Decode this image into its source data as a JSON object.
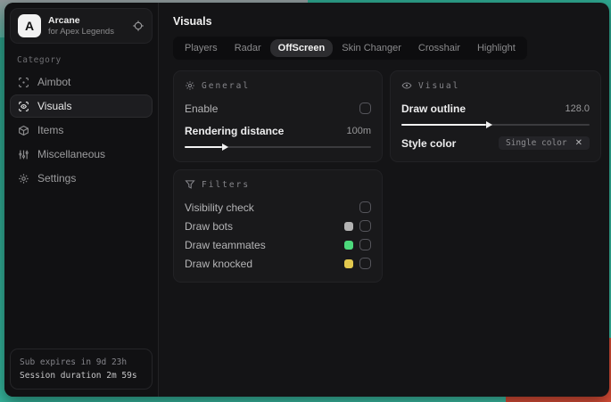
{
  "sidebar": {
    "logo_letter": "A",
    "app_name": "Arcane",
    "app_subtitle": "for Apex Legends",
    "category_label": "Category",
    "items": [
      {
        "label": "Aimbot",
        "icon": "aimbot-crosshair",
        "selected": false
      },
      {
        "label": "Visuals",
        "icon": "scan-eye",
        "selected": true
      },
      {
        "label": "Items",
        "icon": "package",
        "selected": false
      },
      {
        "label": "Miscellaneous",
        "icon": "sliders",
        "selected": false
      },
      {
        "label": "Settings",
        "icon": "gear",
        "selected": false
      }
    ],
    "footer": {
      "line1": "Sub expires in 9d 23h",
      "line2": "Session duration 2m 59s"
    }
  },
  "main": {
    "title": "Visuals",
    "tabs": [
      {
        "label": "Players",
        "selected": false
      },
      {
        "label": "Radar",
        "selected": false
      },
      {
        "label": "OffScreen",
        "selected": true
      },
      {
        "label": "Skin Changer",
        "selected": false
      },
      {
        "label": "Crosshair",
        "selected": false
      },
      {
        "label": "Highlight",
        "selected": false
      }
    ],
    "panels": {
      "general": {
        "title": "General",
        "enable_label": "Enable",
        "enable_checked": false,
        "rendering": {
          "label": "Rendering distance",
          "value": "100m",
          "fill": "20%"
        }
      },
      "visual": {
        "title": "Visual",
        "outline": {
          "label": "Draw outline",
          "value": "128.0",
          "fill": "45%"
        },
        "style": {
          "label": "Style color",
          "value": "Single color",
          "clear": "✕"
        }
      },
      "filters": {
        "title": "Filters",
        "rows": [
          {
            "label": "Visibility check",
            "swatch": null,
            "checked": false
          },
          {
            "label": "Draw bots",
            "swatch": "#b3b3b3",
            "checked": false
          },
          {
            "label": "Draw teammates",
            "swatch": "#4cd97b",
            "checked": false
          },
          {
            "label": "Draw knocked",
            "swatch": "#e2c84e",
            "checked": false
          }
        ]
      }
    }
  },
  "colors": {
    "accent_teal": "#35b89e",
    "desktop_red": "#df4f38",
    "swatch_gray": "#b3b3b3",
    "swatch_green": "#4cd97b",
    "swatch_yellow": "#e2c84e"
  }
}
